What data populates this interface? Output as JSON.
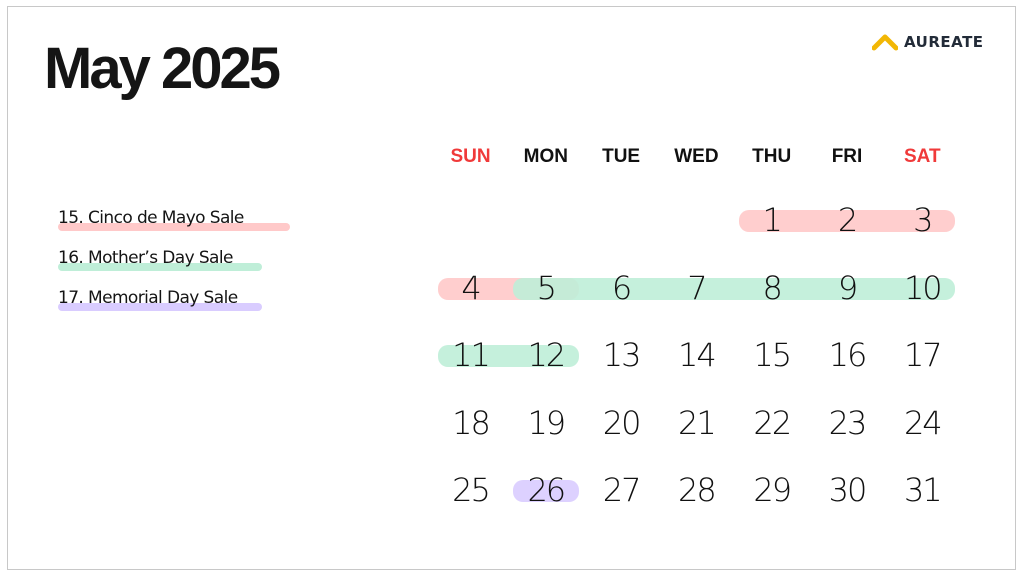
{
  "title": "May 2025",
  "logo": {
    "text": "AUREATE",
    "icon": "chevron-up-icon",
    "color": "#f2b705"
  },
  "colors": {
    "weekend": "#f03a3a",
    "weekday": "#111111",
    "cinco": "#ffc9c9",
    "mothers": "#bfeed8",
    "memorial": "#d9ccff"
  },
  "legend": [
    {
      "label": "15. Cinco de Mayo Sale",
      "color": "#ffc9c9"
    },
    {
      "label": "16. Mother’s Day Sale",
      "color": "#bfeed8"
    },
    {
      "label": "17. Memorial Day Sale",
      "color": "#d9ccff"
    }
  ],
  "weekdays": [
    "SUN",
    "MON",
    "TUE",
    "WED",
    "THU",
    "FRI",
    "SAT"
  ],
  "weekend_days": [
    "SUN",
    "SAT"
  ],
  "first_weekday_index": 4,
  "days_in_month": 31,
  "highlights": [
    {
      "event": "Cinco de Mayo Sale",
      "color": "#ffc9c9",
      "from": 1,
      "to": 3
    },
    {
      "event": "Cinco de Mayo Sale",
      "color": "#ffc9c9",
      "from": 4,
      "to": 5
    },
    {
      "event": "Mother’s Day Sale",
      "color": "#bfeed8",
      "from": 5,
      "to": 10
    },
    {
      "event": "Mother’s Day Sale",
      "color": "#bfeed8",
      "from": 11,
      "to": 12
    },
    {
      "event": "Memorial Day Sale",
      "color": "#d9ccff",
      "from": 26,
      "to": 26
    }
  ]
}
